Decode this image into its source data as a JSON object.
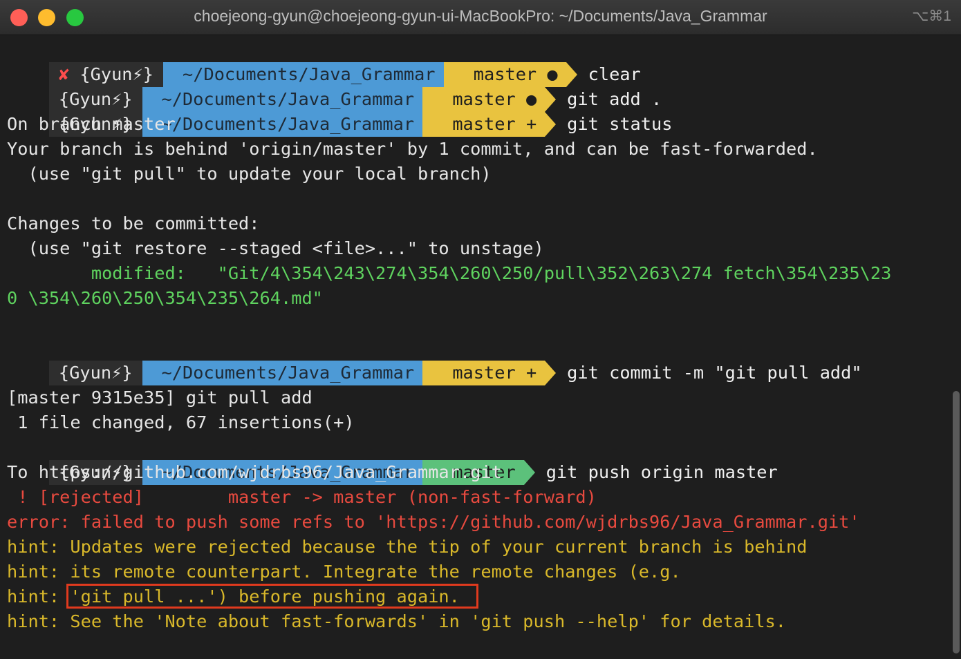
{
  "window": {
    "title": "choejeong-gyun@choejeong-gyun-ui-MacBookPro: ~/Documents/Java_Grammar",
    "shortcut": "⌥⌘1"
  },
  "prompt": {
    "x_mark": "✘",
    "context": "{Gyun⚡}",
    "path": "~/Documents/Java_Grammar",
    "branch_icon": "",
    "branch": "master",
    "status_dirty": "●",
    "status_staged": "+"
  },
  "commands": {
    "c1": "clear",
    "c2": "git add .",
    "c3": "git status",
    "c4": "git commit -m \"git pull add\"",
    "c5": "git push origin master"
  },
  "output": {
    "s1": "On branch master",
    "s2": "Your branch is behind 'origin/master' by 1 commit, and can be fast-forwarded.",
    "s3": "  (use \"git pull\" to update your local branch)",
    "s4": "Changes to be committed:",
    "s5": "  (use \"git restore --staged <file>...\" to unstage)",
    "s6": "        modified:   \"Git/4\\354\\243\\274\\354\\260\\250/pull\\352\\263\\274 fetch\\354\\235\\23",
    "s7": "0 \\354\\260\\250\\354\\235\\264.md\"",
    "m1": "[master 9315e35] git pull add",
    "m2": " 1 file changed, 67 insertions(+)",
    "p1": "To https://github.com/wjdrbs96/Java_Grammar.git",
    "p2": " ! [rejected]        master -> master (non-fast-forward)",
    "p3": "error: failed to push some refs to 'https://github.com/wjdrbs96/Java_Grammar.git'",
    "p4": "hint: Updates were rejected because the tip of your current branch is behind",
    "p5": "hint: its remote counterpart. Integrate the remote changes (e.g.",
    "p6": "hint: 'git pull ...') before pushing again.",
    "p7": "hint: See the 'Note about fast-forwards' in 'git push --help' for details."
  },
  "colors": {
    "background": "#1e1e1e",
    "path_segment": "#4d9ad6",
    "branch_dirty": "#e9c33f",
    "branch_clean": "#5cc17b",
    "error_red": "#e84a3f",
    "hint_yellow": "#d9b82a",
    "modified_green": "#5fd35f",
    "highlight_box": "#e03a1e"
  }
}
